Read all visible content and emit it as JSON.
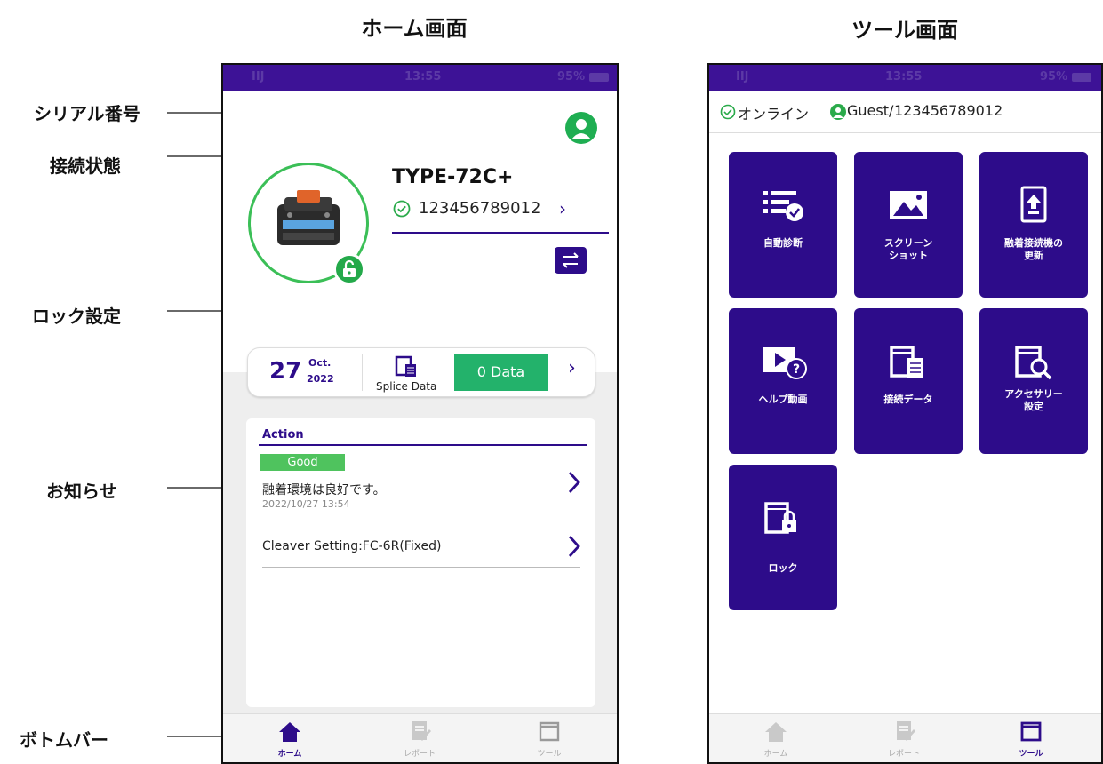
{
  "headings": {
    "home": "ホーム画面",
    "tools": "ツール画面"
  },
  "callouts": {
    "serial": "シリアル番号",
    "connection": "接続状態",
    "lock": "ロック設定",
    "notice": "お知らせ",
    "bottombar": "ボトムバー"
  },
  "home": {
    "status_time": "13:55",
    "status_carrier": "IIJ",
    "status_battery": "95%",
    "model": "TYPE-72C+",
    "serial": "123456789012",
    "date_day": "27",
    "date_month": "Oct.",
    "date_year": "2022",
    "splice_label": "Splice Data",
    "data_button": "0 Data",
    "action_header": "Action",
    "notice_badge": "Good",
    "notice_text": "融着環境は良好です。",
    "notice_time": "2022/10/27 13:54",
    "cleaver_text": "Cleaver Setting:FC-6R(Fixed)",
    "tabs": [
      "ホーム",
      "レポート",
      "ツール"
    ]
  },
  "tools": {
    "status_time": "13:55",
    "status_carrier": "IIJ",
    "status_battery": "95%",
    "online": "オンライン",
    "user": "Guest/",
    "serial": "123456789012",
    "tiles": [
      "自動診断",
      "スクリーン\nショット",
      "融着接続機の\n更新",
      "ヘルプ動画",
      "接続データ",
      "アクセサリー\n設定",
      "ロック"
    ],
    "tabs": [
      "ホーム",
      "レポート",
      "ツール"
    ]
  },
  "colors": {
    "accent": "#2d0c8a",
    "status": "#3d1296",
    "green": "#1fae52",
    "data_button": "#23b26b",
    "good": "#4fc35e"
  }
}
